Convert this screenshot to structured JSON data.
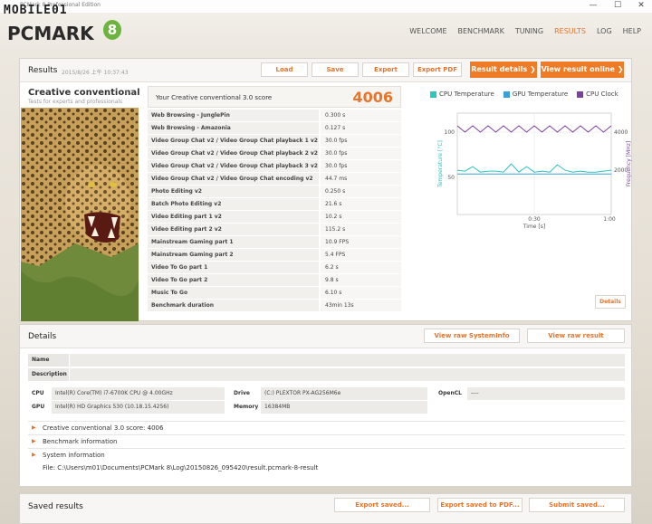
{
  "window": {
    "title": "PCMark 8 Professional Edition",
    "min": "—",
    "max": "☐",
    "close": "✕"
  },
  "logo": {
    "watermark": "MOBILE01",
    "brand": "PCMARK",
    "eight": "8"
  },
  "nav": [
    {
      "label": "WELCOME",
      "active": false
    },
    {
      "label": "BENCHMARK",
      "active": false
    },
    {
      "label": "TUNING",
      "active": false
    },
    {
      "label": "RESULTS",
      "active": true
    },
    {
      "label": "LOG",
      "active": false
    },
    {
      "label": "HELP",
      "active": false
    }
  ],
  "results": {
    "title": "Results",
    "date": "2015/8/26 上午 10:37:43",
    "load": "Load",
    "save": "Save",
    "export": "Export",
    "export_pdf": "Export PDF",
    "result_details": "Result details ❯",
    "view_online": "View result online ❯",
    "bench_name": "Creative conventional",
    "bench_version": "3.0",
    "bench_sub": "Tests for experts and professionals",
    "score_label": "Your Creative conventional 3.0 score",
    "score": "4006",
    "rows": [
      {
        "name": "Web Browsing - JunglePin",
        "value": "0.300 s"
      },
      {
        "name": "Web Browsing - Amazonia",
        "value": "0.127 s"
      },
      {
        "name": "Video Group Chat v2 / Video Group Chat playback 1 v2",
        "value": "30.0 fps"
      },
      {
        "name": "Video Group Chat v2 / Video Group Chat playback 2 v2",
        "value": "30.0 fps"
      },
      {
        "name": "Video Group Chat v2 / Video Group Chat playback 3 v2",
        "value": "30.0 fps"
      },
      {
        "name": "Video Group Chat v2 / Video Group Chat encoding v2",
        "value": "44.7 ms"
      },
      {
        "name": "Photo Editing v2",
        "value": "0.250 s"
      },
      {
        "name": "Batch Photo Editing v2",
        "value": "21.6 s"
      },
      {
        "name": "Video Editing part 1 v2",
        "value": "10.2 s"
      },
      {
        "name": "Video Editing part 2 v2",
        "value": "115.2 s"
      },
      {
        "name": "Mainstream Gaming part 1",
        "value": "10.9 FPS"
      },
      {
        "name": "Mainstream Gaming part 2",
        "value": "5.4 FPS"
      },
      {
        "name": "Video To Go part 1",
        "value": "6.2 s"
      },
      {
        "name": "Video To Go part 2",
        "value": "9.8 s"
      },
      {
        "name": "Music To Go",
        "value": "6.10 s"
      },
      {
        "name": "Benchmark duration",
        "value": "43min 13s"
      }
    ],
    "details_btn": "Details"
  },
  "chart_data": {
    "type": "line",
    "series": [
      {
        "name": "CPU Temperature",
        "color": "#2ec4c0",
        "x": [
          0,
          3,
          6,
          9,
          12,
          15,
          18,
          21,
          24,
          27,
          30,
          33,
          36,
          39,
          42,
          45,
          48,
          51,
          54,
          57,
          60
        ],
        "y": [
          48,
          47,
          52,
          46,
          47,
          47,
          46,
          55,
          46,
          52,
          46,
          47,
          46,
          54,
          48,
          46,
          47,
          46,
          46,
          47,
          48
        ]
      },
      {
        "name": "GPU Temperature",
        "color": "#3aa0d8",
        "x": [
          0,
          3,
          6,
          9,
          12,
          15,
          18,
          21,
          24,
          27,
          30,
          33,
          36,
          39,
          42,
          45,
          48,
          51,
          54,
          57,
          60
        ],
        "y": [
          44,
          44,
          44,
          44,
          44,
          44,
          44,
          44,
          44,
          44,
          44,
          44,
          44,
          44,
          44,
          44,
          44,
          44,
          44,
          44,
          44
        ]
      },
      {
        "name": "CPU Clock",
        "color": "#7b3fa0",
        "x": [
          0,
          3,
          6,
          9,
          12,
          15,
          18,
          21,
          24,
          27,
          30,
          33,
          36,
          39,
          42,
          45,
          48,
          51,
          54,
          57,
          60
        ],
        "y": [
          4200,
          3900,
          4200,
          3900,
          4200,
          3900,
          4200,
          3900,
          4200,
          3900,
          4200,
          3900,
          4200,
          3900,
          4200,
          3900,
          4200,
          3900,
          4200,
          3900,
          4200
        ]
      }
    ],
    "xlabel": "Time [s]",
    "ylabel_left": "Temperature [°C]",
    "ylabel_right": "Frequency [MHz]",
    "xticks": [
      "0:30",
      "1:00"
    ],
    "ylim_left": [
      0,
      110
    ],
    "yticks_left": [
      "100",
      "50"
    ],
    "ylim_right": [
      0,
      4800
    ],
    "yticks_right": [
      "4000",
      "2000"
    ]
  },
  "details": {
    "title": "Details",
    "view_sysinfo": "View raw SystemInfo",
    "view_result": "View raw result",
    "name_label": "Name",
    "desc_label": "Description",
    "cpu_label": "CPU",
    "cpu": "Intel(R) Core(TM) i7-6700K CPU @ 4.00GHz",
    "gpu_label": "GPU",
    "gpu": "Intel(R) HD Graphics 530 (10.18.15.4256)",
    "drive_label": "Drive",
    "drive": "(C:) PLEXTOR PX-AG256M6e",
    "memory_label": "Memory",
    "memory": "16384MB",
    "opencl_label": "OpenCL",
    "opencl": "----",
    "exp1": "Creative conventional 3.0 score: 4006",
    "exp2": "Benchmark information",
    "exp3": "System information",
    "file": "File: C:\\Users\\m01\\Documents\\PCMark 8\\Log\\20150826_095420\\result.pcmark-8-result"
  },
  "saved": {
    "title": "Saved results",
    "export_saved": "Export saved...",
    "export_pdf": "Export saved to PDF...",
    "submit": "Submit saved..."
  }
}
